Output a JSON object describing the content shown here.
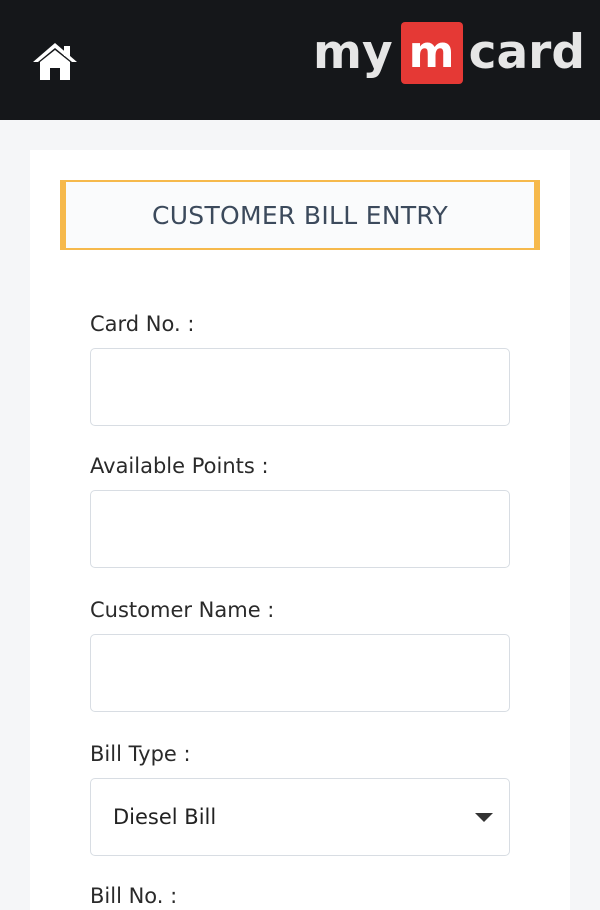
{
  "header": {
    "home_icon": "home-icon",
    "logo": {
      "prefix": "my",
      "mark": "m",
      "suffix": "card"
    },
    "colors": {
      "background": "#15171a",
      "mark": "#e53935",
      "text": "#e6e6e6"
    }
  },
  "form": {
    "title": "CUSTOMER BILL ENTRY",
    "accent_color": "#f6b94c",
    "fields": {
      "card_no": {
        "label": "Card No. :",
        "value": ""
      },
      "available_points": {
        "label": "Available Points :",
        "value": ""
      },
      "customer_name": {
        "label": "Customer Name :",
        "value": ""
      },
      "bill_type": {
        "label": "Bill Type :",
        "selected": "Diesel Bill"
      },
      "bill_no": {
        "label": "Bill No. :"
      }
    }
  }
}
